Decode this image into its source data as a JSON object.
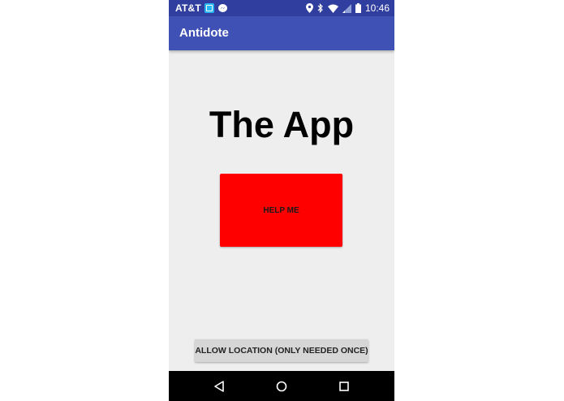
{
  "status_bar": {
    "carrier": "AT&T",
    "time": "10:46",
    "icons": [
      "app-notification-icon",
      "messenger-icon",
      "location-icon",
      "bluetooth-icon",
      "wifi-icon",
      "signal-icon",
      "battery-icon"
    ]
  },
  "app_bar": {
    "title": "Antidote"
  },
  "main": {
    "headline": "The App",
    "help_button_label": "HELP ME",
    "location_button_label": "ALLOW LOCATION (ONLY NEEDED ONCE)"
  },
  "colors": {
    "status_bar": "#303f9f",
    "app_bar": "#3f51b5",
    "help_button": "#ff0000",
    "background": "#eeeeee"
  },
  "nav_bar": {
    "icons": [
      "back-icon",
      "home-icon",
      "recents-icon"
    ]
  }
}
